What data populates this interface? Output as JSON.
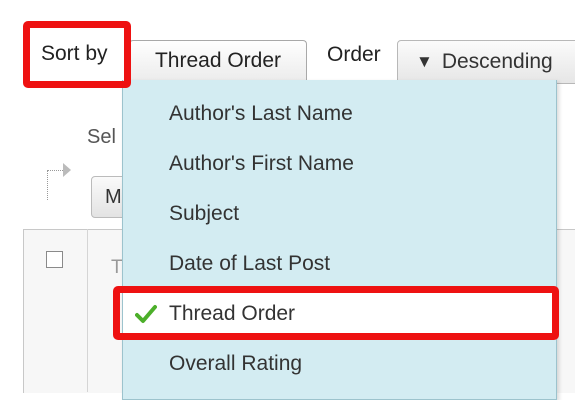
{
  "sort": {
    "label": "Sort by",
    "selected": "Thread Order",
    "options": [
      {
        "label": "Author's Last Name",
        "selected": false
      },
      {
        "label": "Author's First Name",
        "selected": false
      },
      {
        "label": "Subject",
        "selected": false
      },
      {
        "label": "Date of Last Post",
        "selected": false
      },
      {
        "label": "Thread Order",
        "selected": true
      },
      {
        "label": "Overall Rating",
        "selected": false
      }
    ]
  },
  "order": {
    "label": "Order",
    "selected": "Descending",
    "arrow_glyph": "▼"
  },
  "background": {
    "select_partial": "Sel",
    "button_partial": "M",
    "row_partial": "T"
  },
  "colors": {
    "highlight": "#ee1111",
    "dropdown_bg": "#d3ecf2",
    "check": "#4caf2a"
  },
  "icons": {
    "check": "check-icon"
  }
}
